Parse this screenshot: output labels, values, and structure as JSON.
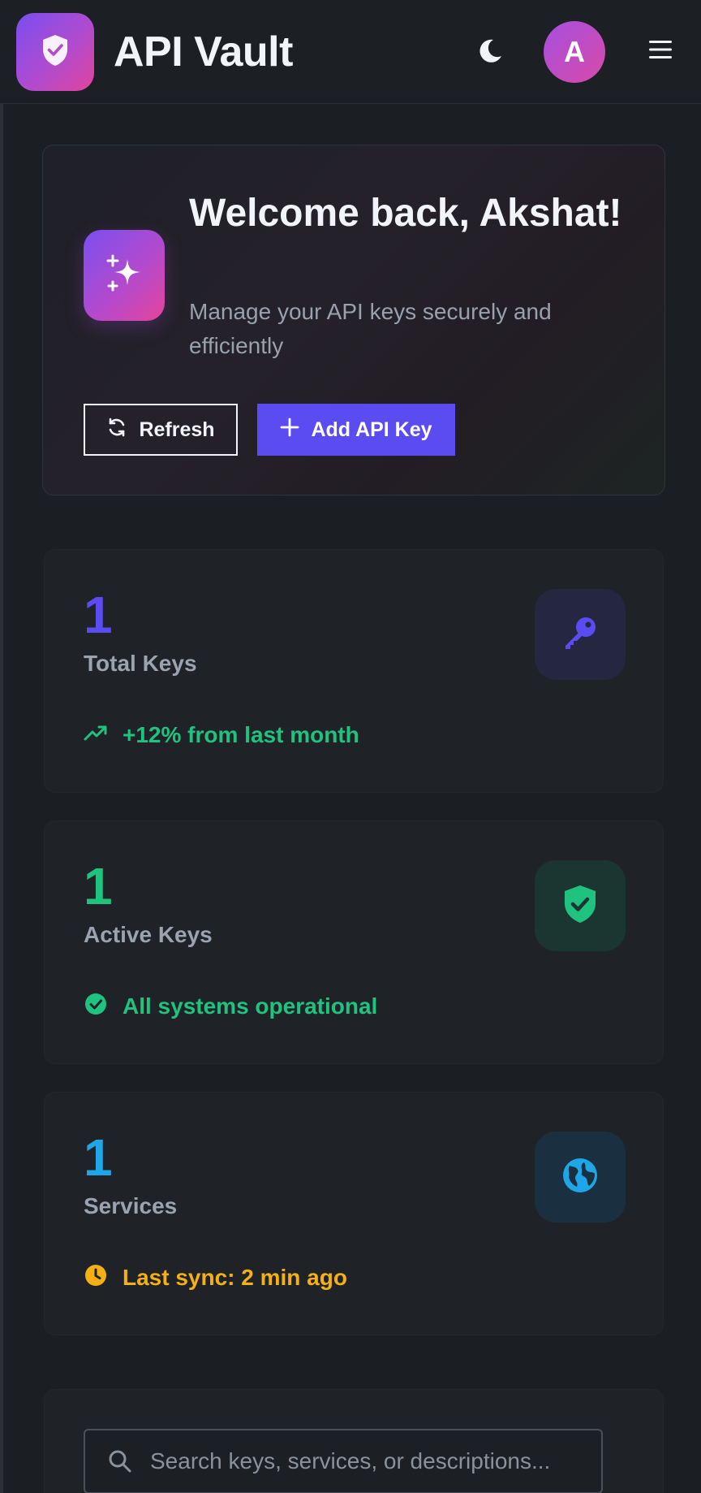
{
  "header": {
    "app_title": "API Vault",
    "logo_icon": "shield-check-icon",
    "theme_toggle_icon": "moon-icon",
    "avatar_initial": "A",
    "menu_icon": "hamburger-menu-icon"
  },
  "welcome": {
    "title": "Welcome back, Akshat!",
    "subtitle": "Manage your API keys securely and efficiently",
    "icon": "sparkles-icon",
    "refresh_label": "Refresh",
    "add_label": "Add API Key"
  },
  "stats": [
    {
      "value": "1",
      "label": "Total Keys",
      "icon": "key-icon",
      "footer": "+12% from last month",
      "footer_icon": "trending-up-icon",
      "value_color": "#5b4cf2",
      "footer_color": "#20c27f"
    },
    {
      "value": "1",
      "label": "Active Keys",
      "icon": "shield-check-icon",
      "footer": "All systems operational",
      "footer_icon": "check-circle-icon",
      "value_color": "#20c27f",
      "footer_color": "#20c27f"
    },
    {
      "value": "1",
      "label": "Services",
      "icon": "globe-icon",
      "footer": "Last sync: 2 min ago",
      "footer_icon": "clock-icon",
      "value_color": "#1fa6e6",
      "footer_color": "#f5b014"
    }
  ],
  "search": {
    "placeholder": "Search keys, services, or descriptions...",
    "value": ""
  },
  "colors": {
    "background": "#1b1e22",
    "card": "#1f2226",
    "primary": "#5b4cf2",
    "success": "#20c27f",
    "info": "#1fa6e6",
    "warning": "#f5b014"
  }
}
